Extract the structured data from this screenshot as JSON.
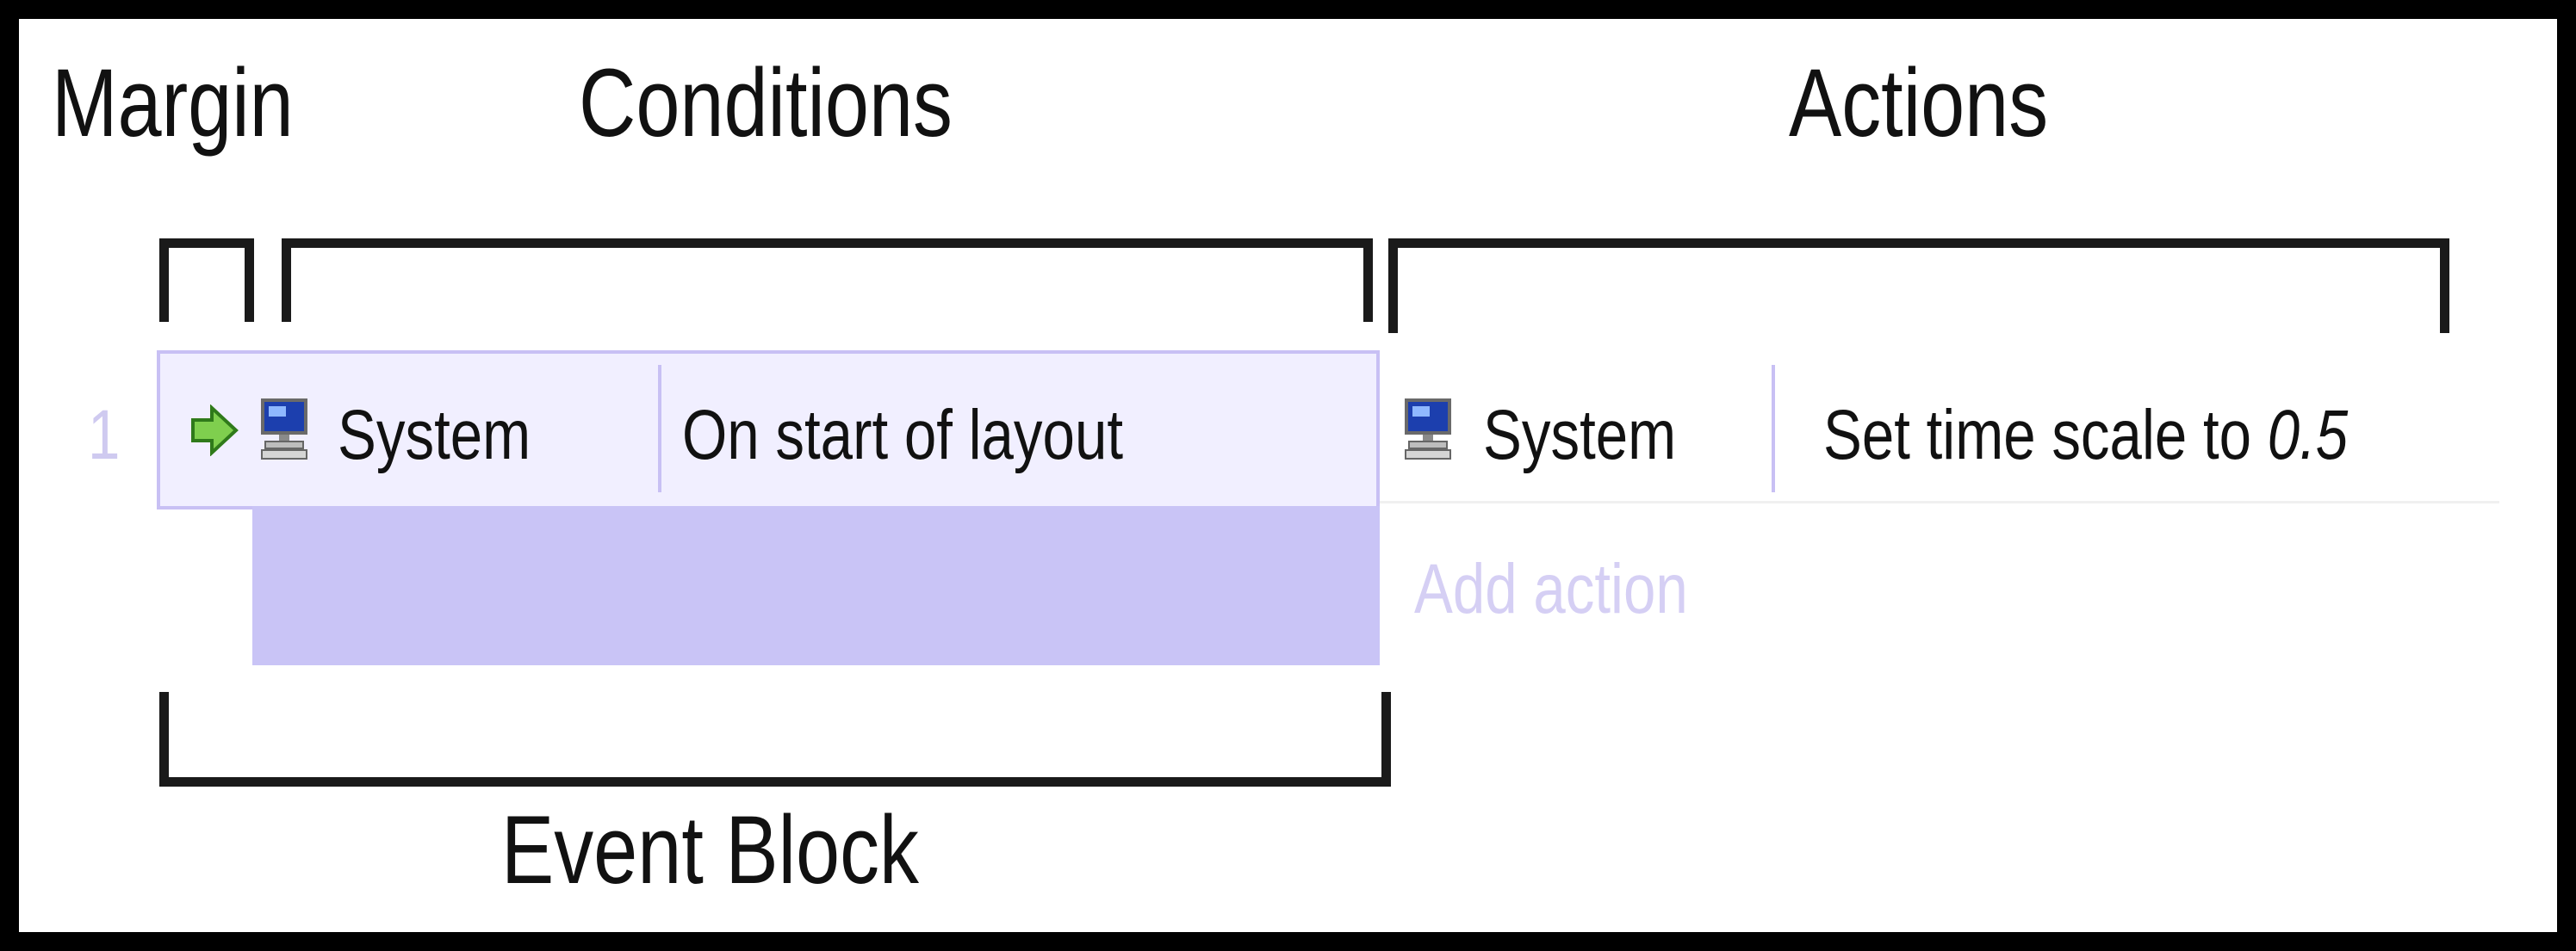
{
  "labels": {
    "margin": "Margin",
    "conditions": "Conditions",
    "actions": "Actions",
    "event_block": "Event Block"
  },
  "event": {
    "number": "1",
    "condition": {
      "object": "System",
      "text": "On start of layout"
    },
    "action": {
      "object": "System",
      "text_prefix": "Set time scale to ",
      "value": "0.5"
    },
    "add_action": "Add action"
  },
  "colors": {
    "condition_bg": "#f1efff",
    "condition_border": "#c8c0f4",
    "event_block_fill": "#c9c4f6",
    "add_action_text": "#d5cff4",
    "trigger_arrow": "#3a9a22"
  },
  "icons": {
    "trigger": "green-arrow-icon",
    "system": "computer-monitor-icon"
  }
}
